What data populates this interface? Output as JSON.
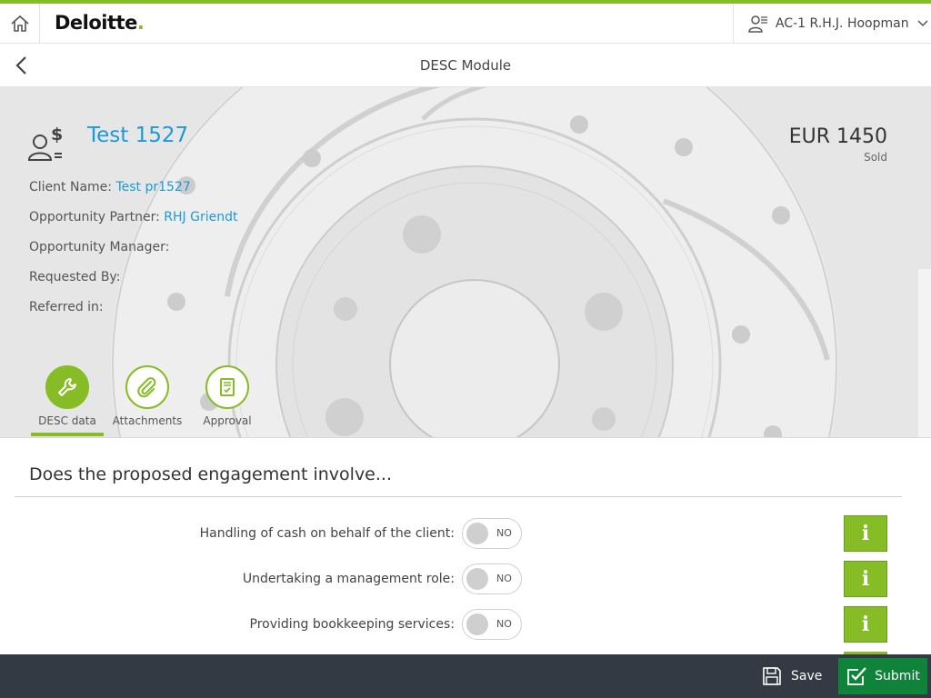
{
  "colors": {
    "accent": "#86bc25",
    "link": "#1a9ad6",
    "footer": "#333a43",
    "submit": "#10833a"
  },
  "header": {
    "home_icon": "home-icon",
    "brand": "Deloitte",
    "brand_dot": ".",
    "user_icon": "user-list-icon",
    "user_name": "AC-1 R.H.J. Hoopman",
    "dropdown_icon": "chevron-down-icon"
  },
  "subheader": {
    "back_icon": "chevron-left-icon",
    "title": "DESC Module"
  },
  "record": {
    "icon": "client-dollar-icon",
    "title": "Test 1527",
    "amount": "EUR 1450",
    "status": "Sold",
    "fields": [
      {
        "label": "Client Name:",
        "value": "Test pr1527"
      },
      {
        "label": "Opportunity Partner:",
        "value": "RHJ Griendt"
      },
      {
        "label": "Opportunity Manager:",
        "value": ""
      },
      {
        "label": "Requested By:",
        "value": ""
      },
      {
        "label": "Referred in:",
        "value": ""
      }
    ]
  },
  "tabs": [
    {
      "label": "DESC data",
      "icon": "wrench-icon",
      "active": true
    },
    {
      "label": "Attachments",
      "icon": "paperclip-icon",
      "active": false
    },
    {
      "label": "Approval",
      "icon": "document-check-icon",
      "active": false
    }
  ],
  "section": {
    "title": "Does the proposed engagement involve...",
    "questions": [
      {
        "label": "Handling of cash on behalf of the client:",
        "toggle": "NO",
        "info": "i"
      },
      {
        "label": "Undertaking a management role:",
        "toggle": "NO",
        "info": "i"
      },
      {
        "label": "Providing bookkeeping services:",
        "toggle": "NO",
        "info": "i"
      }
    ]
  },
  "footer": {
    "save_label": "Save",
    "save_icon": "floppy-disk-icon",
    "submit_label": "Submit",
    "submit_icon": "checkbox-icon"
  }
}
